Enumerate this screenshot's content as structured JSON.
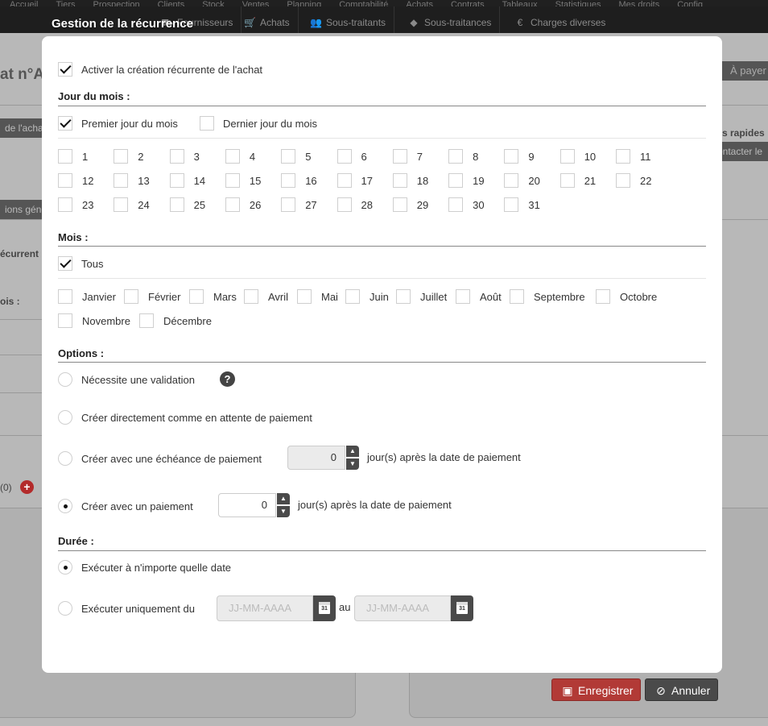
{
  "background": {
    "top_nav": [
      "Accueil",
      "Tiers",
      "Prospection",
      "Clients",
      "Stock",
      "Ventes",
      "Planning",
      "Comptabilité",
      "Achats",
      "Contrats",
      "Tableaux",
      "Statistiques",
      "Mes droits",
      "Config"
    ],
    "sub_tabs": [
      {
        "icon": "truck-icon",
        "glyph": "⛟",
        "label": "Fournisseurs"
      },
      {
        "icon": "cart-icon",
        "glyph": "🛒",
        "label": "Achats"
      },
      {
        "icon": "users-icon",
        "glyph": "👥",
        "label": "Sous-traitants"
      },
      {
        "icon": "tag-icon",
        "glyph": "◆",
        "label": "Sous-traitances"
      },
      {
        "icon": "euro-icon",
        "glyph": "€",
        "label": "Charges diverses"
      }
    ],
    "page_title": "at n°A",
    "right_button": "À payer",
    "tag_achat": "de l'achat",
    "tag_rapides": "s rapides",
    "tag_contacter": "ontacter le",
    "tag_generales": "ions géné",
    "label_recurrence": "écurrent",
    "label_mois": "ois :",
    "count_text": "(0)"
  },
  "modal": {
    "title": "Gestion de la récurrence",
    "activate": {
      "label": "Activer la création récurrente de l'achat",
      "checked": true
    },
    "day_section": {
      "title": "Jour du mois :",
      "first_day": {
        "label": "Premier jour du mois",
        "checked": true
      },
      "last_day": {
        "label": "Dernier jour du mois",
        "checked": false
      },
      "days": [
        "1",
        "2",
        "3",
        "4",
        "5",
        "6",
        "7",
        "8",
        "9",
        "10",
        "11",
        "12",
        "13",
        "14",
        "15",
        "16",
        "17",
        "18",
        "19",
        "20",
        "21",
        "22",
        "23",
        "24",
        "25",
        "26",
        "27",
        "28",
        "29",
        "30",
        "31"
      ]
    },
    "month_section": {
      "title": "Mois :",
      "all": {
        "label": "Tous",
        "checked": true
      },
      "months": [
        "Janvier",
        "Février",
        "Mars",
        "Avril",
        "Mai",
        "Juin",
        "Juillet",
        "Août",
        "Septembre",
        "Octobre",
        "Novembre",
        "Décembre"
      ]
    },
    "options_section": {
      "title": "Options :",
      "validation": {
        "label": "Nécessite une validation",
        "help": "?"
      },
      "waiting": {
        "label": "Créer directement comme en attente de paiement"
      },
      "deadline": {
        "label": "Créer avec une échéance de paiement",
        "value": "0",
        "suffix": "jour(s) après la date de paiement"
      },
      "payment": {
        "label": "Créer avec un paiement",
        "value": "0",
        "suffix": "jour(s) après la date de paiement",
        "selected": true
      }
    },
    "duration_section": {
      "title": "Durée :",
      "any_date": {
        "label": "Exécuter à n'importe quelle date",
        "selected": true
      },
      "range": {
        "label": "Exécuter uniquement du",
        "from_placeholder": "JJ-MM-AAAA",
        "to_label": "au",
        "to_placeholder": "JJ-MM-AAAA",
        "calendar_day": "31"
      }
    }
  },
  "footer": {
    "save_label": "Enregistrer",
    "cancel_label": "Annuler"
  },
  "colors": {
    "save_button": "#b23a36",
    "cancel_button": "#4a4a4a",
    "dark_nav": "#1e1e1e"
  }
}
